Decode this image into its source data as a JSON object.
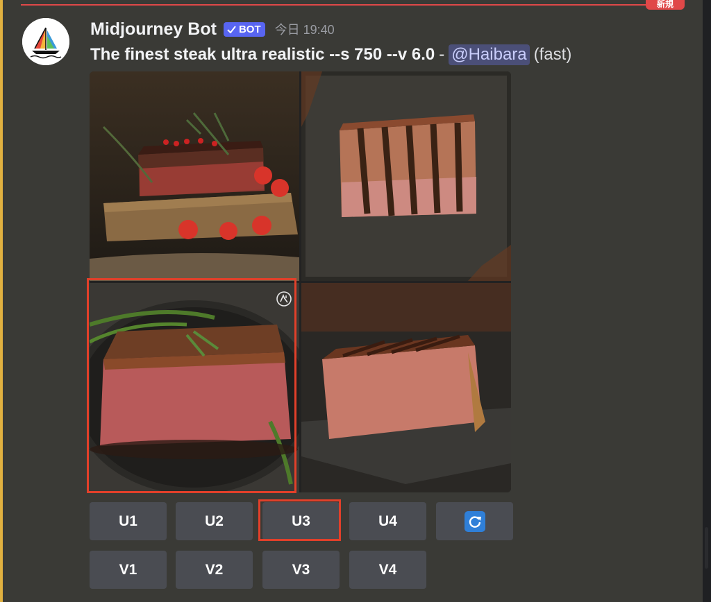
{
  "divider": {
    "badge": "新規"
  },
  "message": {
    "author": "Midjourney Bot",
    "bot_tag": "BOT",
    "timestamp": "今日 19:40",
    "prompt": "The finest steak ultra realistic --s 750 --v 6.0",
    "separator": "-",
    "mention": "@Haibara",
    "speed": "(fast)"
  },
  "image_grid": {
    "tiles": [
      "steak-on-board-with-tomatoes",
      "grilled-steak-on-slate",
      "sliced-steak-with-rosemary",
      "grilled-steak-block"
    ],
    "selected_tile": 3
  },
  "buttons": {
    "upscale": [
      "U1",
      "U2",
      "U3",
      "U4"
    ],
    "variation": [
      "V1",
      "V2",
      "V3",
      "V4"
    ],
    "reroll_icon": "refresh-icon",
    "selected": "U3"
  },
  "colors": {
    "highlight": "#e2402a",
    "bot_tag": "#5865f2",
    "new_divider": "#e04848",
    "button": "#4a4c52"
  }
}
